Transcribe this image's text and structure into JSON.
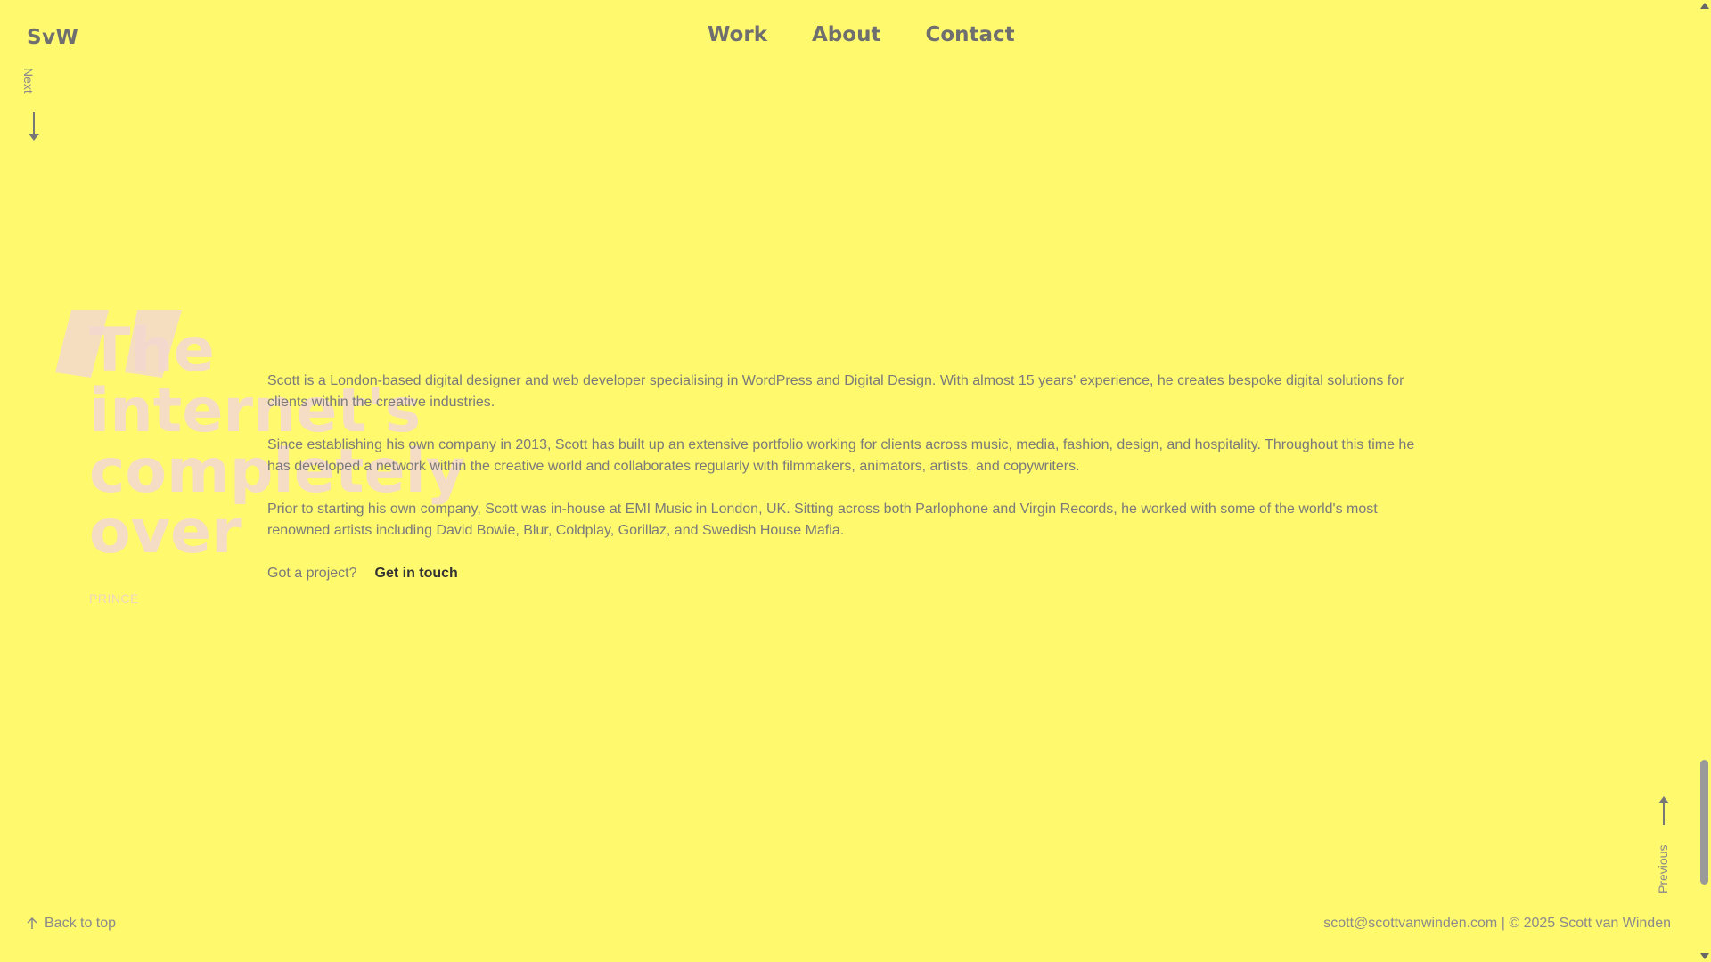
{
  "header": {
    "logo": "SvW",
    "nav": [
      {
        "label": "Work"
      },
      {
        "label": "About"
      },
      {
        "label": "Contact"
      }
    ]
  },
  "pager": {
    "next_label": "Next",
    "previous_label": "Previous"
  },
  "quote": {
    "text": "The internet's completely over",
    "author": "PRINCE"
  },
  "bio": {
    "paragraphs": [
      "Scott is a London-based digital designer and web developer specialising in WordPress and Digital Design. With almost 15 years' experience, he creates bespoke digital solutions for clients within the creative industries.",
      "Since establishing his own company in 2013, Scott has built up an extensive portfolio working for clients across music, media, fashion, design, and hospitality. Throughout this time he has developed a network within the creative world and collaborates regularly with filmmakers, animators, artists, and copywriters.",
      "Prior to starting his own company, Scott was in-house at EMI Music in London, UK. Sitting across both Parlophone and Virgin Records, he worked with some of the world's most renowned artists including David Bowie, Blur, Coldplay, Gorillaz, and Swedish House Mafia."
    ],
    "cta_prompt": "Got a project?",
    "cta_button": "Get in touch"
  },
  "footer": {
    "back_to_top": "Back to top",
    "email": "scott@scottvanwinden.com",
    "separator": "|",
    "copyright": "© 2025 Scott van Winden"
  },
  "colors": {
    "background": "#FFF96E",
    "quote_text": "#F3D9CF",
    "cta_highlight": "#E7C8DE",
    "text": "#7a7a7a"
  },
  "icons": {
    "next": "arrow-down-icon",
    "previous": "arrow-up-icon",
    "back_to_top": "arrow-up-small-icon",
    "quote": "quote-mark-icon"
  }
}
